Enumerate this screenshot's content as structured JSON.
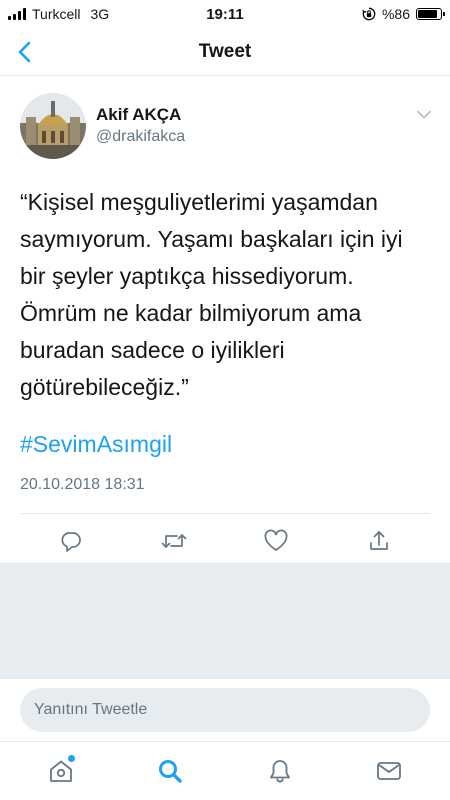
{
  "status_bar": {
    "carrier": "Turkcell",
    "network": "3G",
    "time": "19:11",
    "battery_text": "%86",
    "battery_level": 0.86
  },
  "nav": {
    "title": "Tweet",
    "back_icon": "chevron-left-icon"
  },
  "tweet": {
    "author_name": "Akif AKÇA",
    "author_handle": "@drakifakca",
    "text": "“Kişisel meşguliyetlerimi yaşamdan saymıyorum. Yaşamı başkaları için iyi bir şeyler yaptıkça hissediyorum. Ömrüm ne kadar bilmiyorum ama buradan sadece o iyilikleri götürebileceğiz.”",
    "hashtag": "#SevimAsımgil",
    "timestamp": "20.10.2018 18:31",
    "actions": [
      "reply-icon",
      "retweet-icon",
      "like-icon",
      "share-icon"
    ]
  },
  "reply": {
    "placeholder": "Yanıtını Tweetle"
  },
  "tabbar": {
    "items": [
      "home-icon",
      "search-icon",
      "notifications-icon",
      "messages-icon"
    ],
    "active": "search-icon"
  },
  "colors": {
    "accent": "#1da1f2",
    "secondary_text": "#657786",
    "background_gray": "#e6ecf0"
  }
}
